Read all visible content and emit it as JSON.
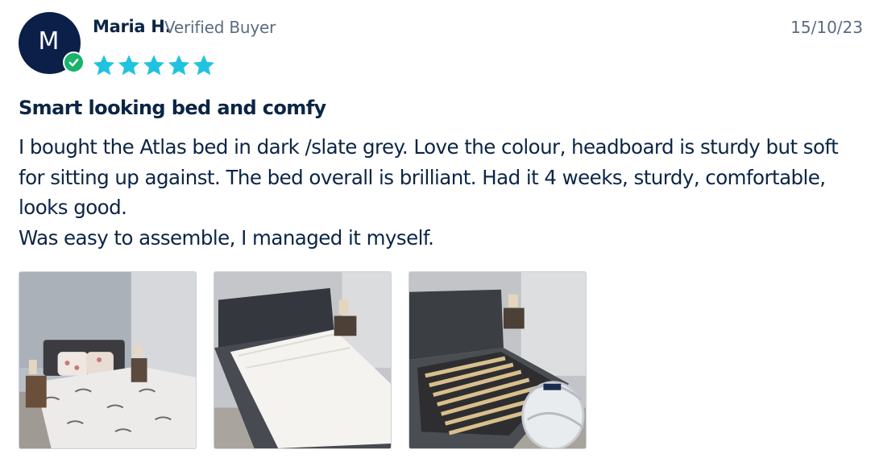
{
  "review": {
    "author": {
      "initial": "M",
      "name": "Maria H.",
      "badge": "Verified Buyer",
      "avatar_color": "#0b1f48",
      "verified_color": "#19b36b"
    },
    "date": "15/10/23",
    "rating": 5,
    "rating_max": 5,
    "star_color": "#1fc3e0",
    "title": "Smart looking bed and comfy",
    "body": [
      "I bought the Atlas bed in dark /slate grey. Love the colour, headboard is sturdy but soft for sitting up against. The bed overall is brilliant. Had it 4 weeks, sturdy, comfortable, looks good.",
      "Was easy to assemble, I managed it myself."
    ],
    "photos": [
      {
        "icon": "bed-with-duvet-photo"
      },
      {
        "icon": "bed-with-mattress-photo"
      },
      {
        "icon": "bed-frame-slats-photo"
      }
    ]
  }
}
